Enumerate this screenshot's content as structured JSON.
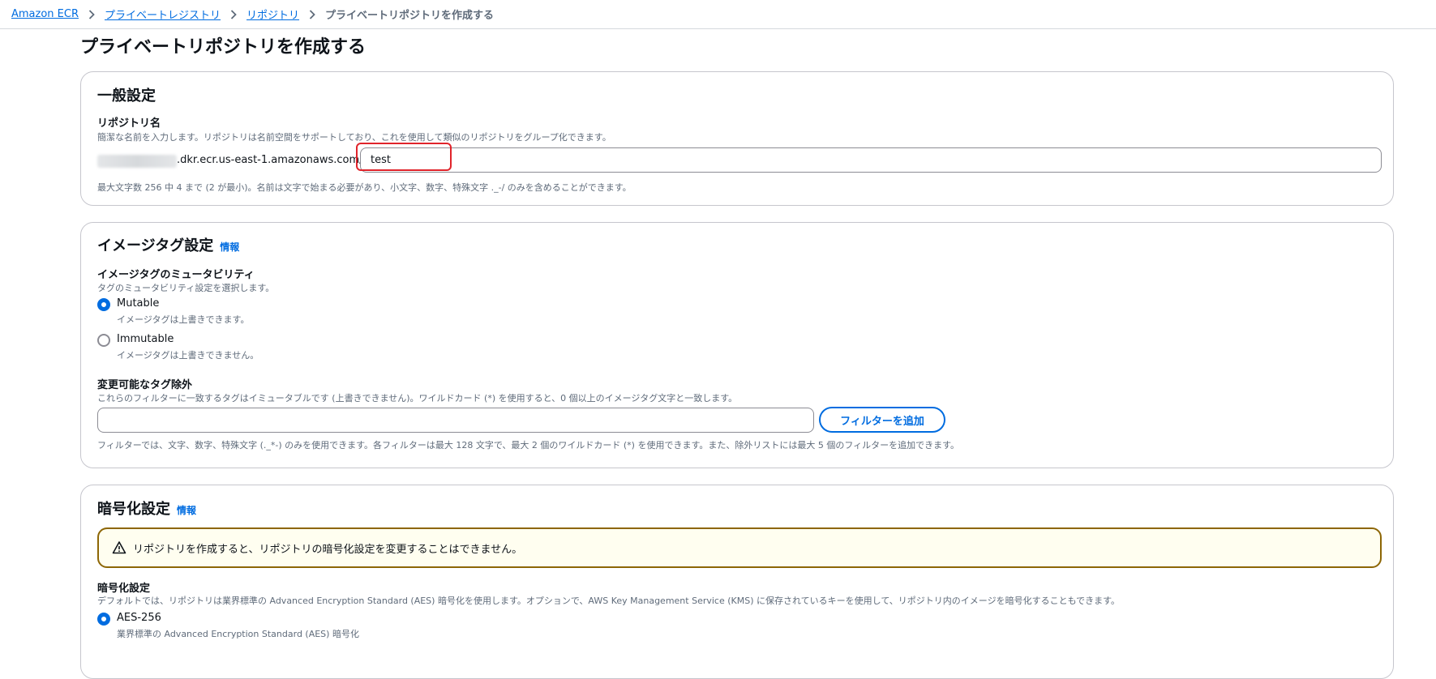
{
  "breadcrumb": {
    "items": [
      "Amazon ECR",
      "プライベートレジストリ",
      "リポジトリ"
    ],
    "current": "プライベートリポジトリを作成する"
  },
  "page_title": "プライベートリポジトリを作成する",
  "general": {
    "title": "一般設定",
    "repo_name_label": "リポジトリ名",
    "repo_name_desc": "簡潔な名前を入力します。リポジトリは名前空間をサポートしており、これを使用して類似のリポジトリをグループ化できます。",
    "uri_suffix": ".dkr.ecr.us-east-1.amazonaws.com/",
    "repo_name_value": "test",
    "constraint": "最大文字数 256 中 4 まで (2 が最小)。名前は文字で始まる必要があり、小文字、数字、特殊文字 ._-/ のみを含めることができます。"
  },
  "image_tag": {
    "title": "イメージタグ設定",
    "info": "情報",
    "mutability_label": "イメージタグのミュータビリティ",
    "mutability_desc": "タグのミュータビリティ設定を選択します。",
    "options": [
      {
        "label": "Mutable",
        "desc": "イメージタグは上書きできます。",
        "checked": true
      },
      {
        "label": "Immutable",
        "desc": "イメージタグは上書きできません。",
        "checked": false
      }
    ],
    "exclusion_label": "変更可能なタグ除外",
    "exclusion_desc": "これらのフィルターに一致するタグはイミュータブルです (上書きできません)。ワイルドカード (*) を使用すると、0 個以上のイメージタグ文字と一致します。",
    "filter_value": "",
    "add_filter_button": "フィルターを追加",
    "filter_hint": "フィルターでは、文字、数字、特殊文字 (._*-) のみを使用できます。各フィルターは最大 128 文字で、最大 2 個のワイルドカード (*) を使用できます。また、除外リストには最大 5 個のフィルターを追加できます。"
  },
  "encryption": {
    "title": "暗号化設定",
    "info": "情報",
    "warning": "リポジトリを作成すると、リポジトリの暗号化設定を変更することはできません。",
    "setting_label": "暗号化設定",
    "setting_desc": "デフォルトでは、リポジトリは業界標準の Advanced Encryption Standard (AES) 暗号化を使用します。オプションで、AWS Key Management Service (KMS) に保存されているキーを使用して、リポジトリ内のイメージを暗号化することもできます。",
    "options": [
      {
        "label": "AES-256",
        "desc": "業界標準の Advanced Encryption Standard (AES) 暗号化",
        "checked": true
      }
    ]
  },
  "colors": {
    "link": "#006ce0",
    "highlight": "#e0242b",
    "warning_border": "#8d6605",
    "warning_bg": "#fffef0"
  }
}
